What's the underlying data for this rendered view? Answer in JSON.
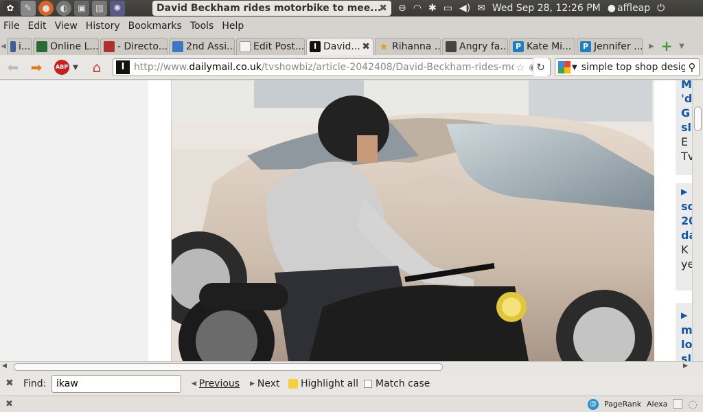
{
  "top_panel": {
    "window_title": "David Beckham rides motorbike to mee...",
    "close_glyph": "✖",
    "datetime": "Wed Sep 28, 12:26 PM",
    "user": "affleap"
  },
  "menu": [
    "File",
    "Edit",
    "View",
    "History",
    "Bookmarks",
    "Tools",
    "Help"
  ],
  "tabs": [
    {
      "label": "i...",
      "fav": "",
      "fav_color": "#3d5e9b"
    },
    {
      "label": "Online L...",
      "fav": "",
      "fav_color": "#2a6a36"
    },
    {
      "label": "- Directo...",
      "fav": "",
      "fav_color": "#b03030"
    },
    {
      "label": "2nd Assi...",
      "fav": "",
      "fav_color": "#3b77c3"
    },
    {
      "label": "Edit Post...",
      "fav": "",
      "fav_color": "#f4f4f4"
    },
    {
      "label": "David...",
      "fav": "I",
      "fav_color": "#111111",
      "active": true
    },
    {
      "label": "Rihanna ...",
      "fav": "★",
      "fav_color": "#d9a21b"
    },
    {
      "label": "Angry fa...",
      "fav": "",
      "fav_color": "#444444"
    },
    {
      "label": "Kate Mi...",
      "fav": "P",
      "fav_color": "#1f7fc3"
    },
    {
      "label": "Jennifer ...",
      "fav": "P",
      "fav_color": "#1f7fc3"
    }
  ],
  "nav": {
    "url_prefix": "http://www.",
    "url_domain": "dailymail.co.uk",
    "url_path": "/tvshowbiz/article-2042408/David-Beckham-rides-mot",
    "search_text": "simple top shop design"
  },
  "sidebar_right": [
    {
      "lines": [
        "M",
        "'d",
        "G",
        "sl"
      ],
      "extra": [
        "E",
        "Tv"
      ]
    },
    {
      "lines": [
        "▶",
        "so",
        "20",
        "da"
      ],
      "extra": [
        "K",
        "ye"
      ]
    },
    {
      "lines": [
        "▶",
        "m",
        "lo",
        "sl"
      ],
      "extra": []
    }
  ],
  "find": {
    "label": "Find:",
    "value": "ikaw",
    "previous": "Previous",
    "next": "Next",
    "highlight": "Highlight all",
    "match_case": "Match case"
  },
  "status": {
    "pagerank": "PageRank",
    "alexa": "Alexa"
  },
  "colors": {
    "link_blue": "#1057a8",
    "panel_dark": "#3c3b37"
  }
}
